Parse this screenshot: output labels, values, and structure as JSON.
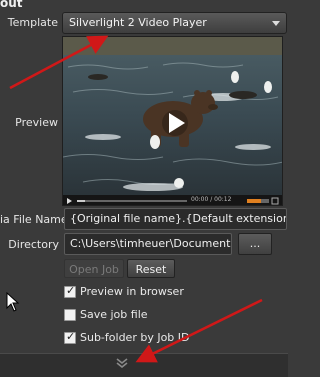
{
  "section": {
    "title": "out"
  },
  "template": {
    "label": "Template",
    "value": "Silverlight 2 Video Player"
  },
  "preview": {
    "label": "Preview",
    "time": "00:00 / 00:12"
  },
  "media_file_name": {
    "label": "ia File Name",
    "value": "{Original file name}.{Default extension}"
  },
  "directory": {
    "label": "Directory",
    "value": "C:\\Users\\timheuer\\Documents\\...",
    "browse_label": "..."
  },
  "buttons": {
    "open_job": "Open Job",
    "reset": "Reset"
  },
  "options": [
    {
      "label": "Preview in browser",
      "checked": true
    },
    {
      "label": "Save job file",
      "checked": false
    },
    {
      "label": "Sub-folder by Job ID",
      "checked": true
    }
  ],
  "colors": {
    "annotation_arrow": "#d01818",
    "background": "#3a3a3a"
  },
  "icons": {
    "play": "play-icon",
    "collapse": "chevron-down-icon",
    "cursor": "mouse-pointer-icon"
  }
}
